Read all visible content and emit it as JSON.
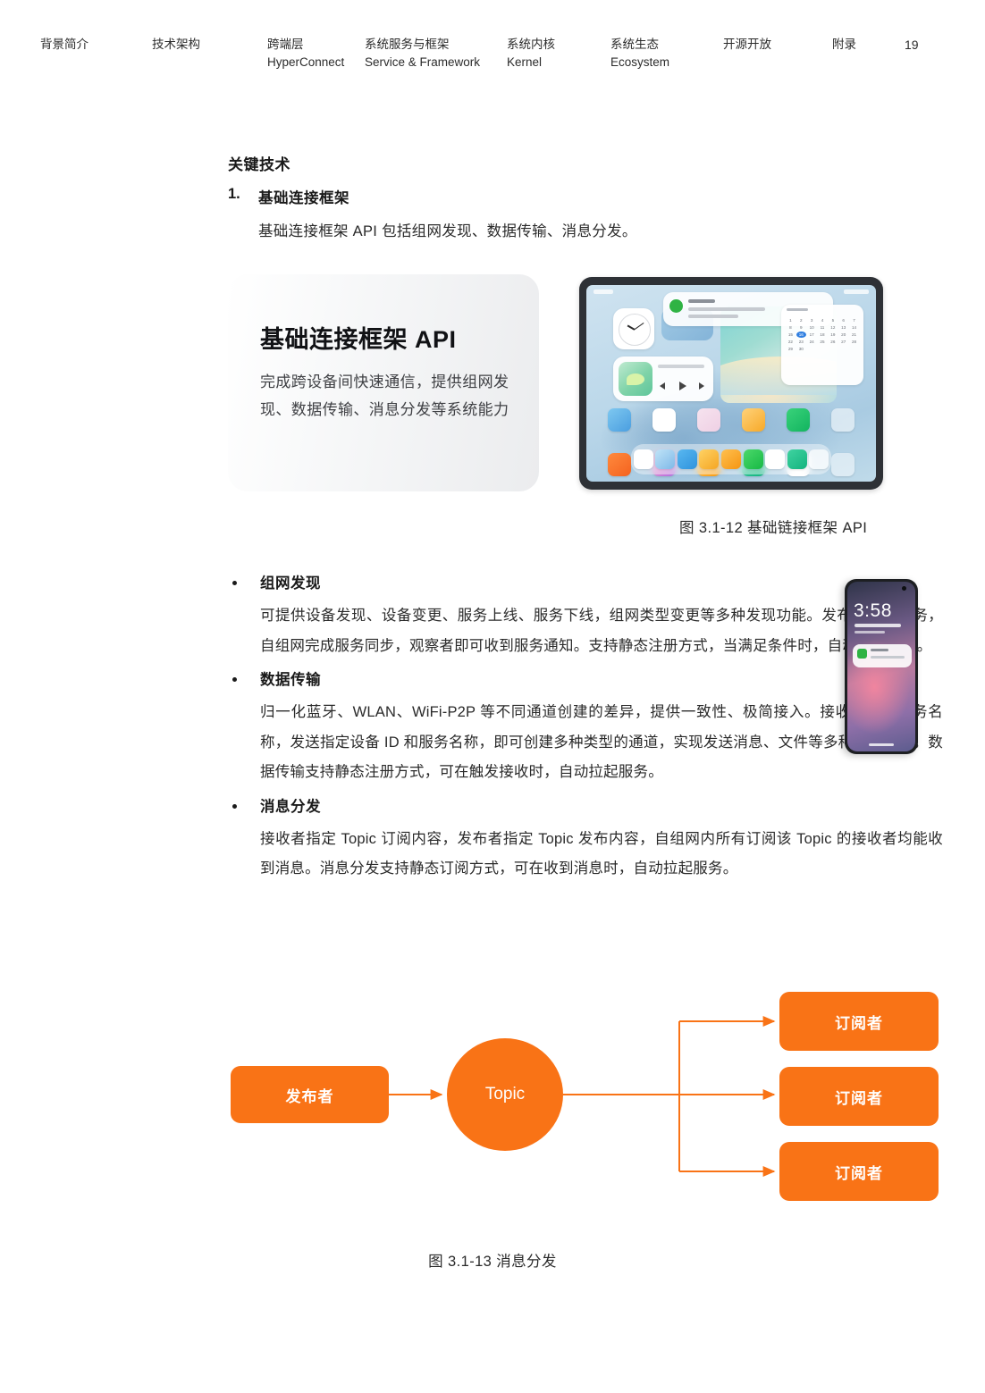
{
  "header": {
    "items": [
      {
        "cn": "背景简介",
        "en": ""
      },
      {
        "cn": "技术架构",
        "en": ""
      },
      {
        "cn": "跨端层",
        "en": "HyperConnect"
      },
      {
        "cn": "系统服务与框架",
        "en": "Service & Framework"
      },
      {
        "cn": "系统内核",
        "en": "Kernel"
      },
      {
        "cn": "系统生态",
        "en": "Ecosystem"
      },
      {
        "cn": "开源开放",
        "en": ""
      },
      {
        "cn": "附录",
        "en": ""
      }
    ],
    "page_number": "19"
  },
  "main": {
    "section_title": "关键技术",
    "item": {
      "number": "1.",
      "title": "基础连接框架",
      "body": "基础连接框架 API 包括组网发现、数据传输、消息分发。"
    },
    "figure_12": {
      "card_title": "基础连接框架 API",
      "card_desc": "完成跨设备间快速通信，提供组网发现、数据传输、消息分发等系统能力",
      "device_tablet_label": "tablet-device",
      "device_phone_label": "phone-device",
      "phone_time": "3:58",
      "caption": "图 3.1-12 基础链接框架 API"
    },
    "bullets": [
      {
        "title": "组网发现",
        "body": "可提供设备发现、设备变更、服务上线、服务下线，组网类型变更等多种发现功能。发布者发布服务，自组网完成服务同步，观察者即可收到服务通知。支持静态注册方式，当满足条件时，自动拉起服务。"
      },
      {
        "title": "数据传输",
        "body": "归一化蓝牙、WLAN、WiFi-P2P 等不同通道创建的差异，提供一致性、极简接入。接收端指定服务名称，发送指定设备 ID 和服务名称，即可创建多种类型的通道，实现发送消息、文件等多种传输能力。数据传输支持静态注册方式，可在触发接收时，自动拉起服务。"
      },
      {
        "title": "消息分发",
        "body": "接收者指定 Topic 订阅内容，发布者指定 Topic 发布内容，自组网内所有订阅该 Topic 的接收者均能收到消息。消息分发支持静态订阅方式，可在收到消息时，自动拉起服务。"
      }
    ],
    "figure_13": {
      "publisher": "发布者",
      "topic": "Topic",
      "subscribers": [
        "订阅者",
        "订阅者",
        "订阅者"
      ],
      "caption": "图 3.1-13 消息分发",
      "accent_color": "#f97316"
    }
  }
}
